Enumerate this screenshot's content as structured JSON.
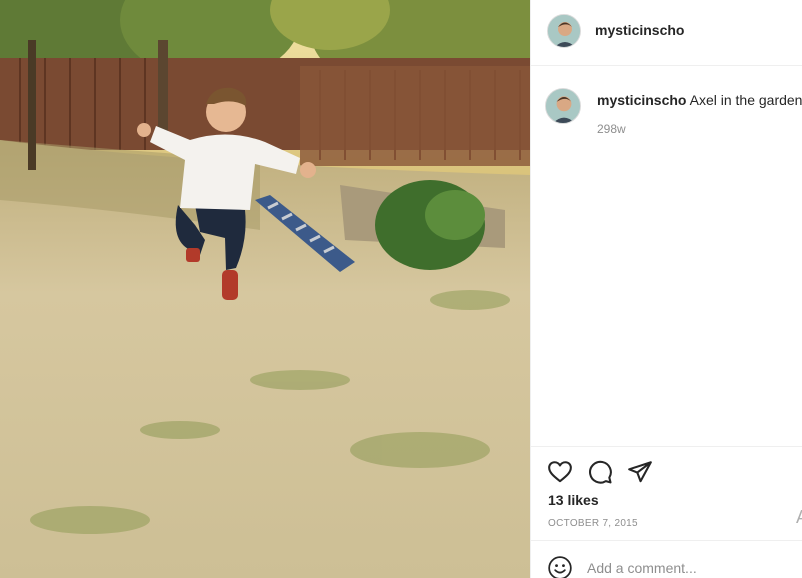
{
  "post": {
    "username": "mysticinscho",
    "caption_user": "mysticinscho",
    "caption_text": "Axel in the garden.",
    "age": "298w",
    "likes": "13 likes",
    "date": "OCTOBER 7, 2015",
    "comment_placeholder": "Add a comment...",
    "edge_glyph": "A"
  },
  "icons": {
    "like": "heart-icon",
    "comment": "comment-bubble-icon",
    "share": "paper-plane-icon",
    "emoji": "smiley-icon"
  },
  "colors": {
    "text": "#262626",
    "muted": "#8e8e8e",
    "border": "#efefef"
  }
}
